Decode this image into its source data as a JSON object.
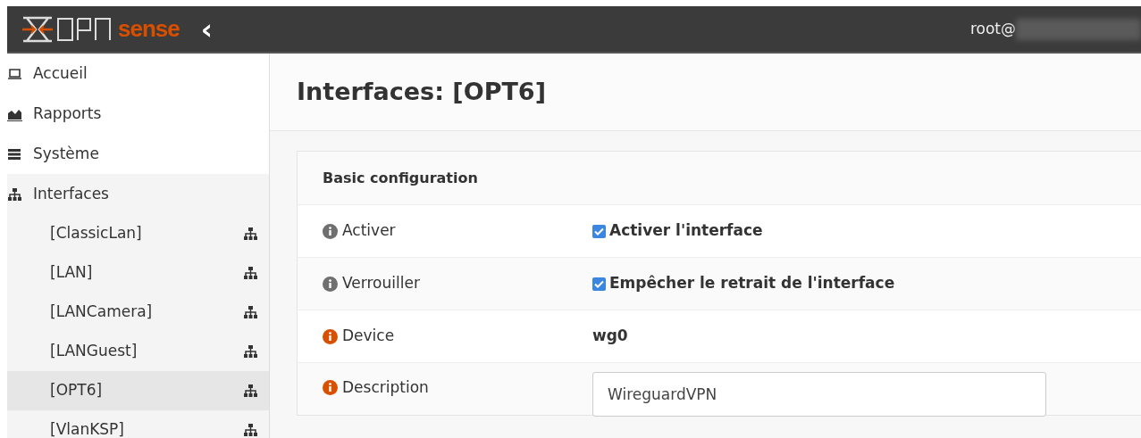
{
  "header": {
    "logo_text": "sense",
    "collapse": "‹",
    "user": "root@"
  },
  "sidebar": {
    "items": [
      {
        "label": "Accueil"
      },
      {
        "label": "Rapports"
      },
      {
        "label": "Système"
      },
      {
        "label": "Interfaces",
        "children": [
          {
            "label": "[ClassicLan]",
            "selected": false
          },
          {
            "label": "[LAN]",
            "selected": false
          },
          {
            "label": "[LANCamera]",
            "selected": false
          },
          {
            "label": "[LANGuest]",
            "selected": false
          },
          {
            "label": "[OPT6]",
            "selected": true
          },
          {
            "label": "[VlanKSP]",
            "selected": false
          }
        ]
      }
    ]
  },
  "page_title": "Interfaces: [OPT6]",
  "section": {
    "title": "Basic configuration",
    "rows": [
      {
        "kind": "checkbox",
        "label": "Activer",
        "color": "#6f6f6f",
        "text": "Activer l'interface",
        "checked": true
      },
      {
        "kind": "checkbox",
        "label": "Verrouiller",
        "color": "#6f6f6f",
        "text": "Empêcher le retrait de l'interface",
        "checked": true
      },
      {
        "kind": "text",
        "label": "Device",
        "color": "#d94f00",
        "text": "wg0"
      },
      {
        "kind": "input",
        "label": "Description",
        "color": "#d94f00",
        "value": "WireguardVPN"
      }
    ]
  }
}
